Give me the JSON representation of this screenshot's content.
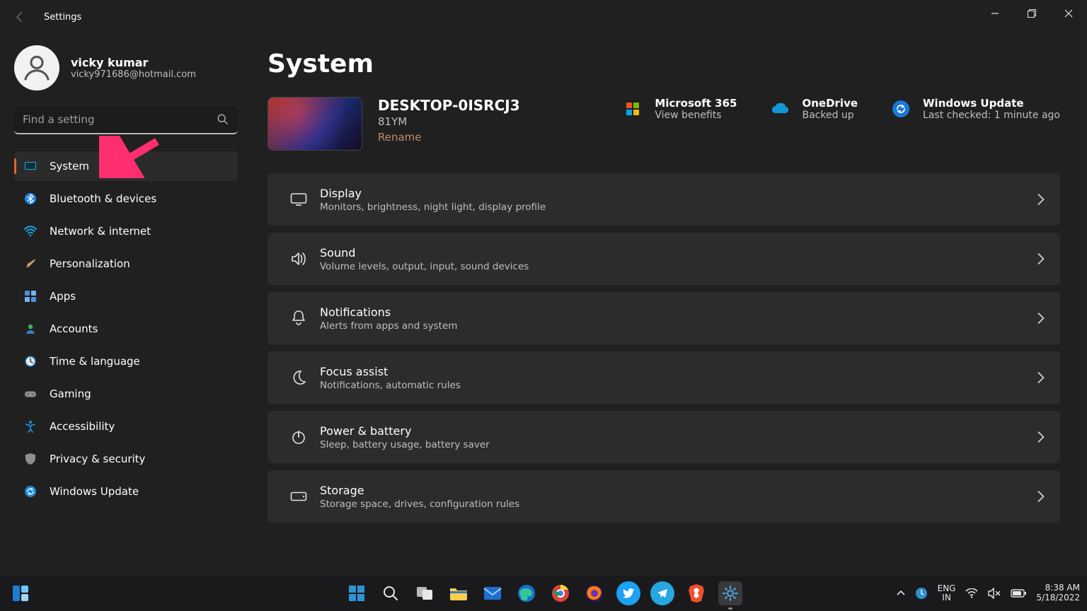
{
  "window": {
    "title": "Settings"
  },
  "user": {
    "name": "vicky kumar",
    "email": "vicky971686@hotmail.com"
  },
  "search": {
    "placeholder": "Find a setting",
    "value": ""
  },
  "sidebar": {
    "items": [
      {
        "label": "System",
        "icon": "system",
        "selected": true
      },
      {
        "label": "Bluetooth & devices",
        "icon": "bluetooth"
      },
      {
        "label": "Network & internet",
        "icon": "wifi"
      },
      {
        "label": "Personalization",
        "icon": "brush"
      },
      {
        "label": "Apps",
        "icon": "apps"
      },
      {
        "label": "Accounts",
        "icon": "person"
      },
      {
        "label": "Time & language",
        "icon": "clock"
      },
      {
        "label": "Gaming",
        "icon": "gamepad"
      },
      {
        "label": "Accessibility",
        "icon": "accessibility"
      },
      {
        "label": "Privacy & security",
        "icon": "shield"
      },
      {
        "label": "Windows Update",
        "icon": "update"
      }
    ]
  },
  "page": {
    "title": "System"
  },
  "device": {
    "name": "DESKTOP-0ISRCJ3",
    "model": "81YM",
    "rename": "Rename"
  },
  "tiles": [
    {
      "title": "Microsoft 365",
      "sub": "View benefits",
      "icon": "ms365"
    },
    {
      "title": "OneDrive",
      "sub": "Backed up",
      "icon": "onedrive"
    },
    {
      "title": "Windows Update",
      "sub": "Last checked: 1 minute ago",
      "icon": "update-badge"
    }
  ],
  "cards": [
    {
      "title": "Display",
      "sub": "Monitors, brightness, night light, display profile",
      "icon": "display"
    },
    {
      "title": "Sound",
      "sub": "Volume levels, output, input, sound devices",
      "icon": "sound"
    },
    {
      "title": "Notifications",
      "sub": "Alerts from apps and system",
      "icon": "bell"
    },
    {
      "title": "Focus assist",
      "sub": "Notifications, automatic rules",
      "icon": "moon"
    },
    {
      "title": "Power & battery",
      "sub": "Sleep, battery usage, battery saver",
      "icon": "power"
    },
    {
      "title": "Storage",
      "sub": "Storage space, drives, configuration rules",
      "icon": "storage"
    }
  ],
  "taskbar": {
    "lang": {
      "line1": "ENG",
      "line2": "IN"
    },
    "clock": {
      "time": "8:38 AM",
      "date": "5/18/2022"
    }
  }
}
